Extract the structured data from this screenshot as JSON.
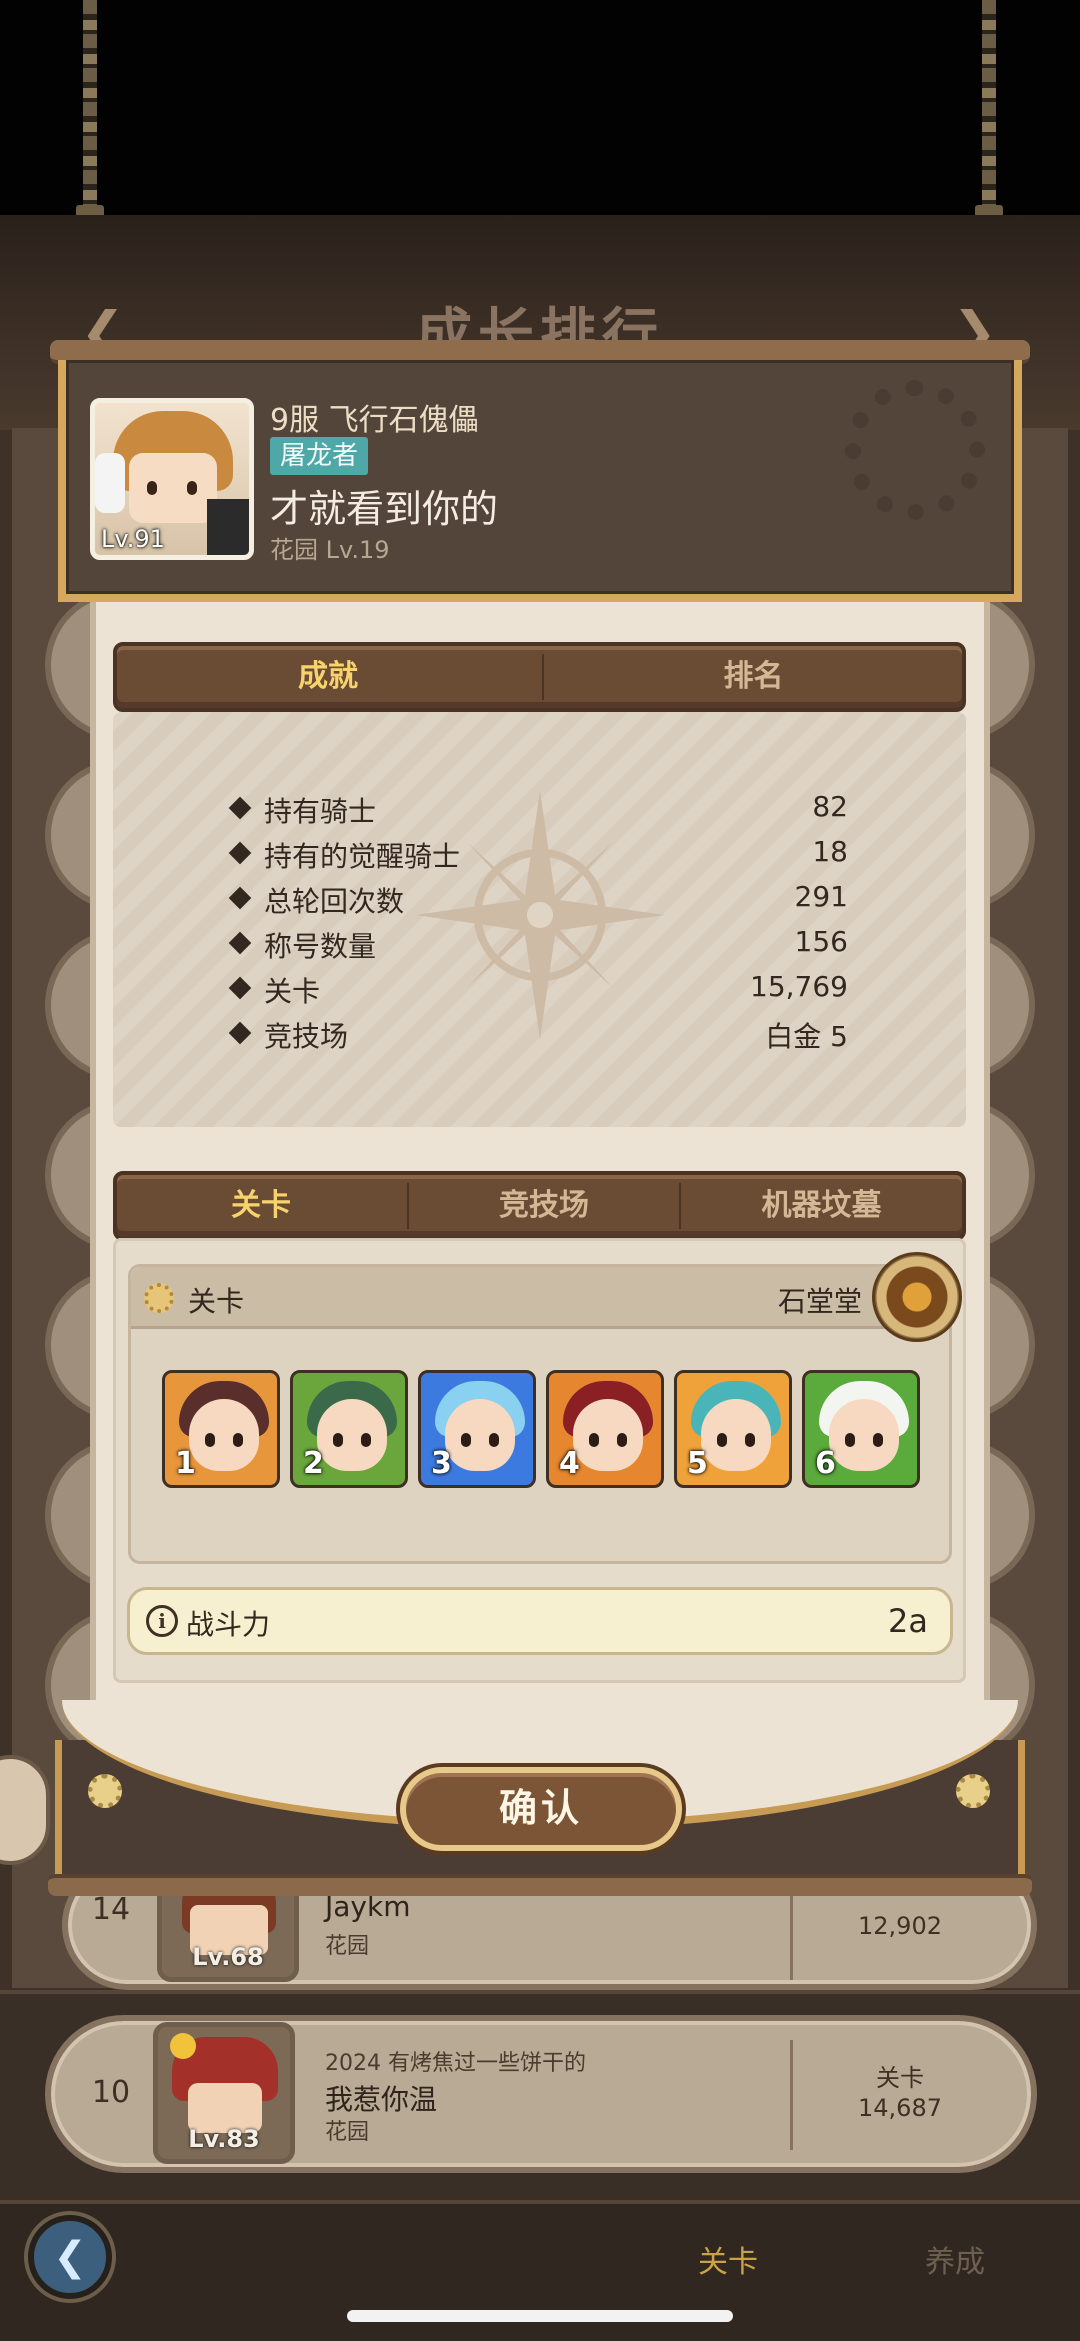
{
  "screen": {
    "title": "成长排行"
  },
  "player": {
    "level": "Lv.91",
    "server_and_name": "9服 飞行石傀儡",
    "title_badge": "屠龙者",
    "motto": "才就看到你的",
    "garden": "花园 Lv.19"
  },
  "stats_tabs": [
    {
      "label": "成就",
      "active": true
    },
    {
      "label": "排名",
      "active": false
    }
  ],
  "stats": [
    {
      "label": "持有骑士",
      "value": "82"
    },
    {
      "label": "持有的觉醒骑士",
      "value": "18"
    },
    {
      "label": "总轮回次数",
      "value": "291"
    },
    {
      "label": "称号数量",
      "value": "156"
    },
    {
      "label": "关卡",
      "value": "15,769"
    },
    {
      "label": "竞技场",
      "value": "白金 5"
    }
  ],
  "mode_tabs": [
    {
      "label": "关卡",
      "active": true
    },
    {
      "label": "竞技场",
      "active": false
    },
    {
      "label": "机器坟墓",
      "active": false
    }
  ],
  "stage_section": {
    "label": "关卡",
    "owner": "石堂堂",
    "heroes": [
      {
        "slot": "1",
        "bg": "#e8963c",
        "hair": "#5a2e2a"
      },
      {
        "slot": "2",
        "bg": "#6aa63c",
        "hair": "#3a6a4a"
      },
      {
        "slot": "3",
        "bg": "#3c7ae0",
        "hair": "#8ad0f0"
      },
      {
        "slot": "4",
        "bg": "#e6862e",
        "hair": "#8a1f24"
      },
      {
        "slot": "5",
        "bg": "#f0a23a",
        "hair": "#4ab5b8"
      },
      {
        "slot": "6",
        "bg": "#5aaa3c",
        "hair": "#f2f5f0"
      }
    ]
  },
  "power": {
    "icon": "info-icon",
    "label": "战斗力",
    "value": "2a"
  },
  "confirm_label": "确认",
  "background_rows": [
    {
      "rank": "14",
      "level": "Lv.68",
      "name": "Jaykm",
      "garden": "花园",
      "stat_value": "12,902"
    },
    {
      "rank": "10",
      "level": "Lv.83",
      "tagline": "2024 有烤焦过一些饼干的",
      "name": "我惹你温",
      "garden": "花园",
      "stat_label": "关卡",
      "stat_value": "14,687"
    }
  ],
  "bottom_tabs": [
    {
      "label": "关卡",
      "active": true,
      "color": "#c9a24a"
    },
    {
      "label": "养成",
      "active": false,
      "color": "#6e6050"
    }
  ],
  "colors": {
    "accent_gold": "#f7d36e",
    "frame_gold": "#d4a85d",
    "badge_teal": "#4fa8a8"
  }
}
